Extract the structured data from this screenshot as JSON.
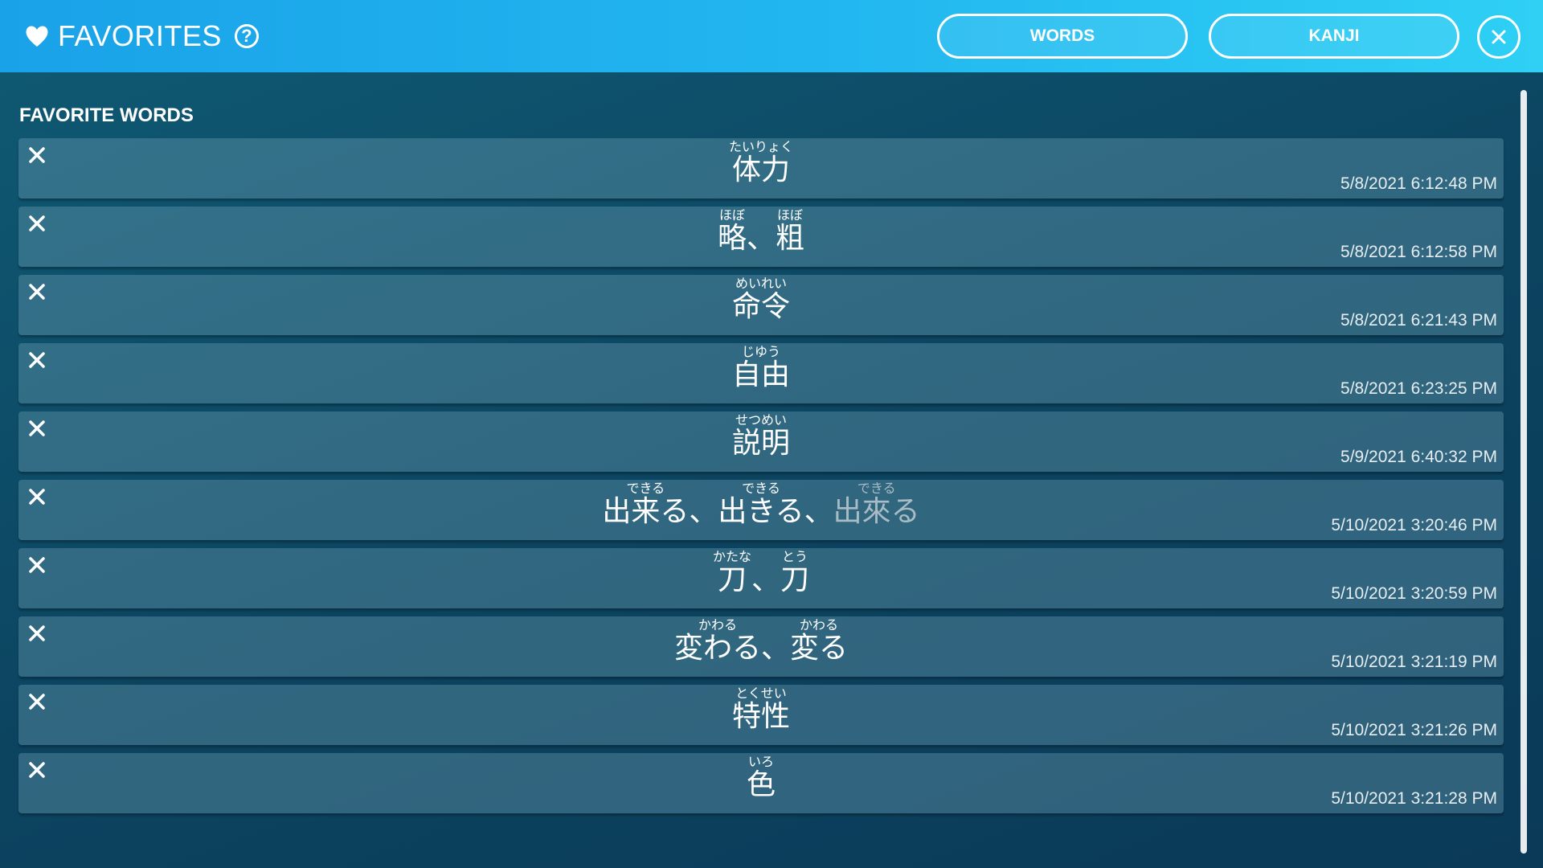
{
  "header": {
    "title": "FAVORITES",
    "help_label": "?",
    "words_button": "WORDS",
    "kanji_button": "KANJI"
  },
  "section": {
    "title": "FAVORITE WORDS"
  },
  "colors": {
    "header_start": "#1aa2e8",
    "header_end": "#2fd0f4",
    "panel": "#0d4a63",
    "row": "#3f7389"
  },
  "favorites": [
    {
      "terms": [
        {
          "furigana": "たいりょく",
          "text": "体力"
        }
      ],
      "timestamp": "5/8/2021 6:12:48 PM"
    },
    {
      "terms": [
        {
          "furigana": "ほぼ",
          "text": "略"
        },
        {
          "furigana": "ほぼ",
          "text": "粗"
        }
      ],
      "timestamp": "5/8/2021 6:12:58 PM"
    },
    {
      "terms": [
        {
          "furigana": "めいれい",
          "text": "命令"
        }
      ],
      "timestamp": "5/8/2021 6:21:43 PM"
    },
    {
      "terms": [
        {
          "furigana": "じゆう",
          "text": "自由"
        }
      ],
      "timestamp": "5/8/2021 6:23:25 PM"
    },
    {
      "terms": [
        {
          "furigana": "せつめい",
          "text": "説明"
        }
      ],
      "timestamp": "5/9/2021 6:40:32 PM"
    },
    {
      "terms": [
        {
          "furigana": "できる",
          "text": "出来る"
        },
        {
          "furigana": "できる",
          "text": "出きる"
        },
        {
          "furigana": "できる",
          "text": "出來る",
          "dim": true
        }
      ],
      "timestamp": "5/10/2021 3:20:46 PM"
    },
    {
      "terms": [
        {
          "furigana": "かたな",
          "text": "刀"
        },
        {
          "furigana": "とう",
          "text": "刀"
        }
      ],
      "timestamp": "5/10/2021 3:20:59 PM"
    },
    {
      "terms": [
        {
          "furigana": "かわる",
          "text": "変わる"
        },
        {
          "furigana": "かわる",
          "text": "変る"
        }
      ],
      "timestamp": "5/10/2021 3:21:19 PM"
    },
    {
      "terms": [
        {
          "furigana": "とくせい",
          "text": "特性"
        }
      ],
      "timestamp": "5/10/2021 3:21:26 PM"
    },
    {
      "terms": [
        {
          "furigana": "いろ",
          "text": "色"
        }
      ],
      "timestamp": "5/10/2021 3:21:28 PM"
    }
  ],
  "separator": "、"
}
